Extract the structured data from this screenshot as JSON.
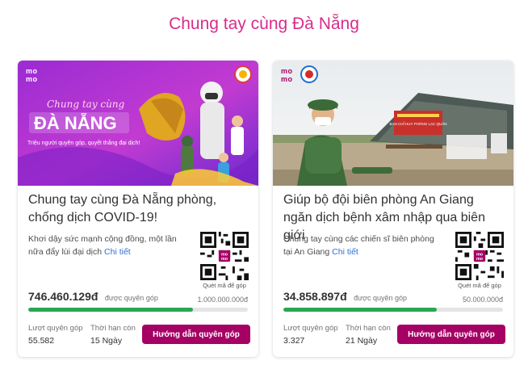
{
  "page": {
    "title": "Chung tay cùng Đà Nẵng"
  },
  "brand": {
    "accent": "#d82d8b",
    "button": "#a50064",
    "progress": "#2aa653"
  },
  "cards": [
    {
      "logo": "momo",
      "hero_script_text": "Chung tay cùng",
      "hero_banner_text": "ĐÀ NẴNG",
      "hero_tagline": "Triệu người quyên góp, quyết thắng đại dịch!",
      "title": "Chung tay cùng Đà Nẵng phòng, chống dịch COVID-19!",
      "description": "Khơi dậy sức mạnh cộng đồng, một lần nữa đẩy lùi đại dịch",
      "detail_link": "Chi tiết",
      "qr_caption": "Quét mã để góp",
      "amount": "746.460.129đ",
      "amount_label": "được quyên góp",
      "goal": "1.000.000.000đ",
      "progress": 0.75,
      "donations_label": "Lượt quyên góp",
      "donations": "55.582",
      "remaining_label": "Thời hạn còn",
      "remaining": "15 Ngày",
      "button_label": "Hướng dẫn quyên góp"
    },
    {
      "logo": "momo",
      "hero_sign_text": "BAN CHỈ HUY PHÒNG LẠC QUÂN",
      "title": "Giúp bộ đội biên phòng An Giang ngăn dịch bệnh xâm nhập qua biên giới",
      "description": "Chung tay cùng các chiến sĩ biên phòng tại An Giang",
      "detail_link": "Chi tiết",
      "qr_caption": "Quét mã để góp",
      "amount": "34.858.897đ",
      "amount_label": "được quyên góp",
      "goal": "50.000.000đ",
      "progress": 0.7,
      "donations_label": "Lượt quyên góp",
      "donations": "3.327",
      "remaining_label": "Thời hạn còn",
      "remaining": "21 Ngày",
      "button_label": "Hướng dẫn quyên góp"
    }
  ]
}
